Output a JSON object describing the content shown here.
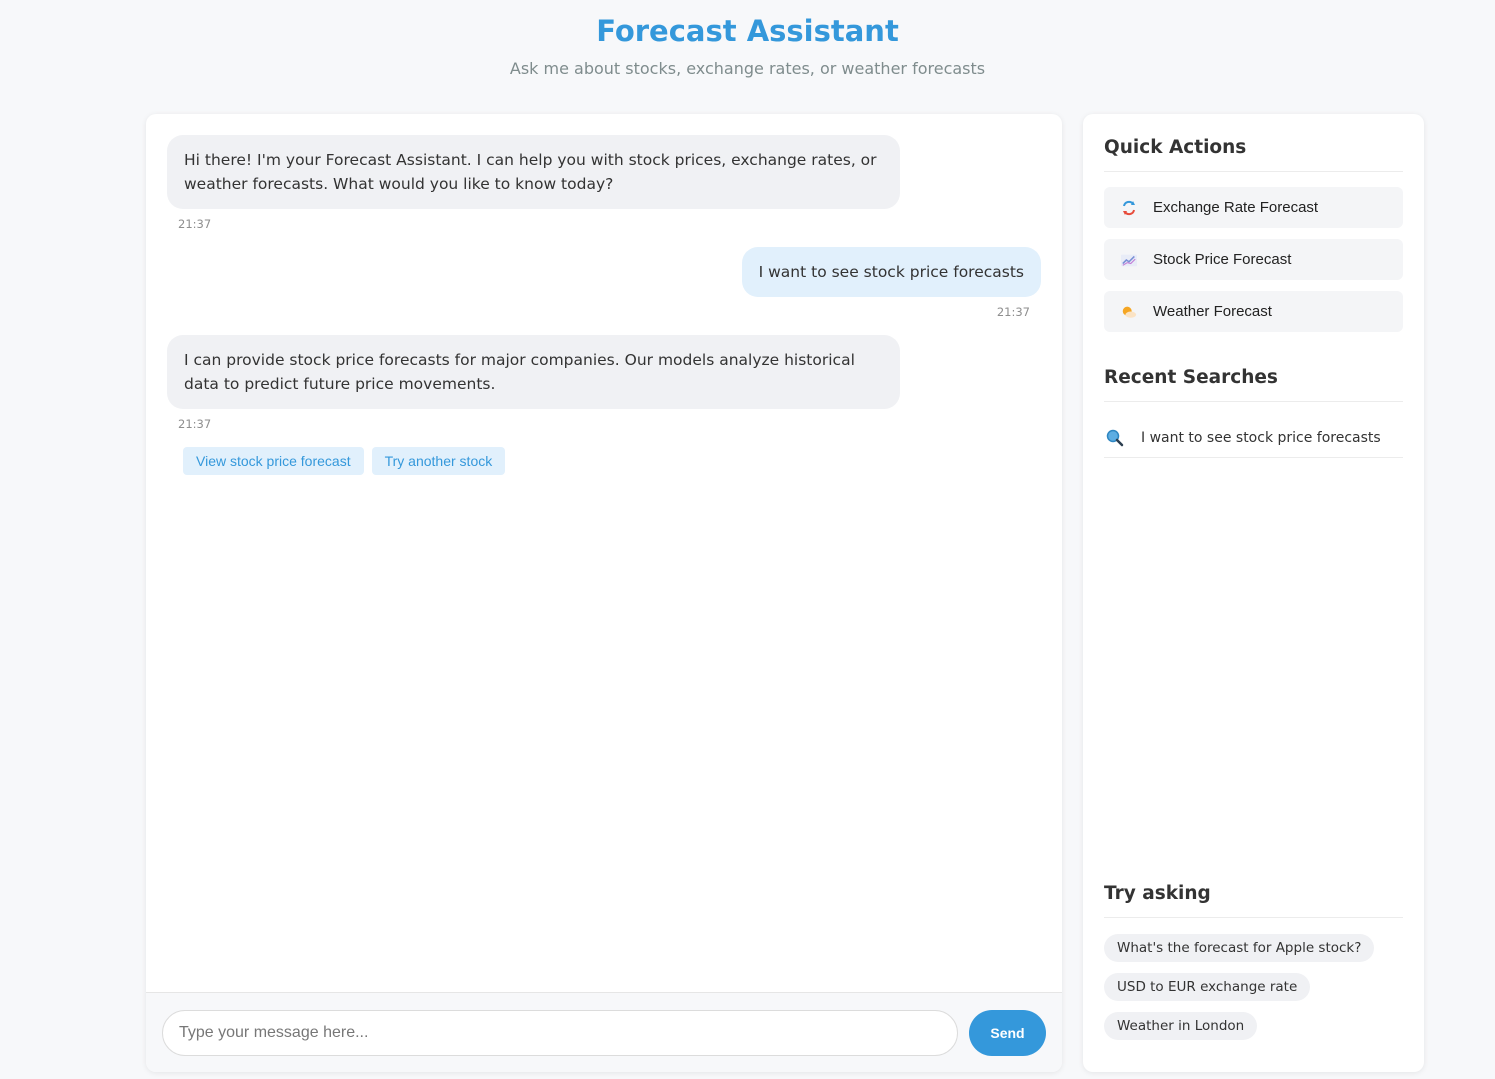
{
  "header": {
    "title": "Forecast Assistant",
    "subtitle": "Ask me about stocks, exchange rates, or weather forecasts"
  },
  "chat": {
    "messages": [
      {
        "role": "bot",
        "text": "Hi there! I'm your Forecast Assistant. I can help you with stock prices, exchange rates, or weather forecasts. What would you like to know today?",
        "time": "21:37"
      },
      {
        "role": "user",
        "text": "I want to see stock price forecasts",
        "time": "21:37"
      },
      {
        "role": "bot",
        "text": "I can provide stock price forecasts for major companies. Our models analyze historical data to predict future price movements.",
        "time": "21:37"
      }
    ],
    "suggestions": [
      "View stock price forecast",
      "Try another stock"
    ]
  },
  "input": {
    "placeholder": "Type your message here...",
    "value": "",
    "send_label": "Send"
  },
  "sidebar": {
    "quick_actions_title": "Quick Actions",
    "quick_actions": [
      {
        "label": "Exchange Rate Forecast",
        "icon": "exchange-icon"
      },
      {
        "label": "Stock Price Forecast",
        "icon": "chart-icon"
      },
      {
        "label": "Weather Forecast",
        "icon": "weather-icon"
      }
    ],
    "recent_title": "Recent Searches",
    "recent": [
      {
        "label": "I want to see stock price forecasts",
        "icon": "search-icon"
      }
    ],
    "try_title": "Try asking",
    "try": [
      "What's the forecast for Apple stock?",
      "USD to EUR exchange rate",
      "Weather in London"
    ]
  },
  "colors": {
    "accent": "#3498db",
    "user_bubble": "#e1f0fc",
    "bot_bubble": "#f0f1f4"
  }
}
